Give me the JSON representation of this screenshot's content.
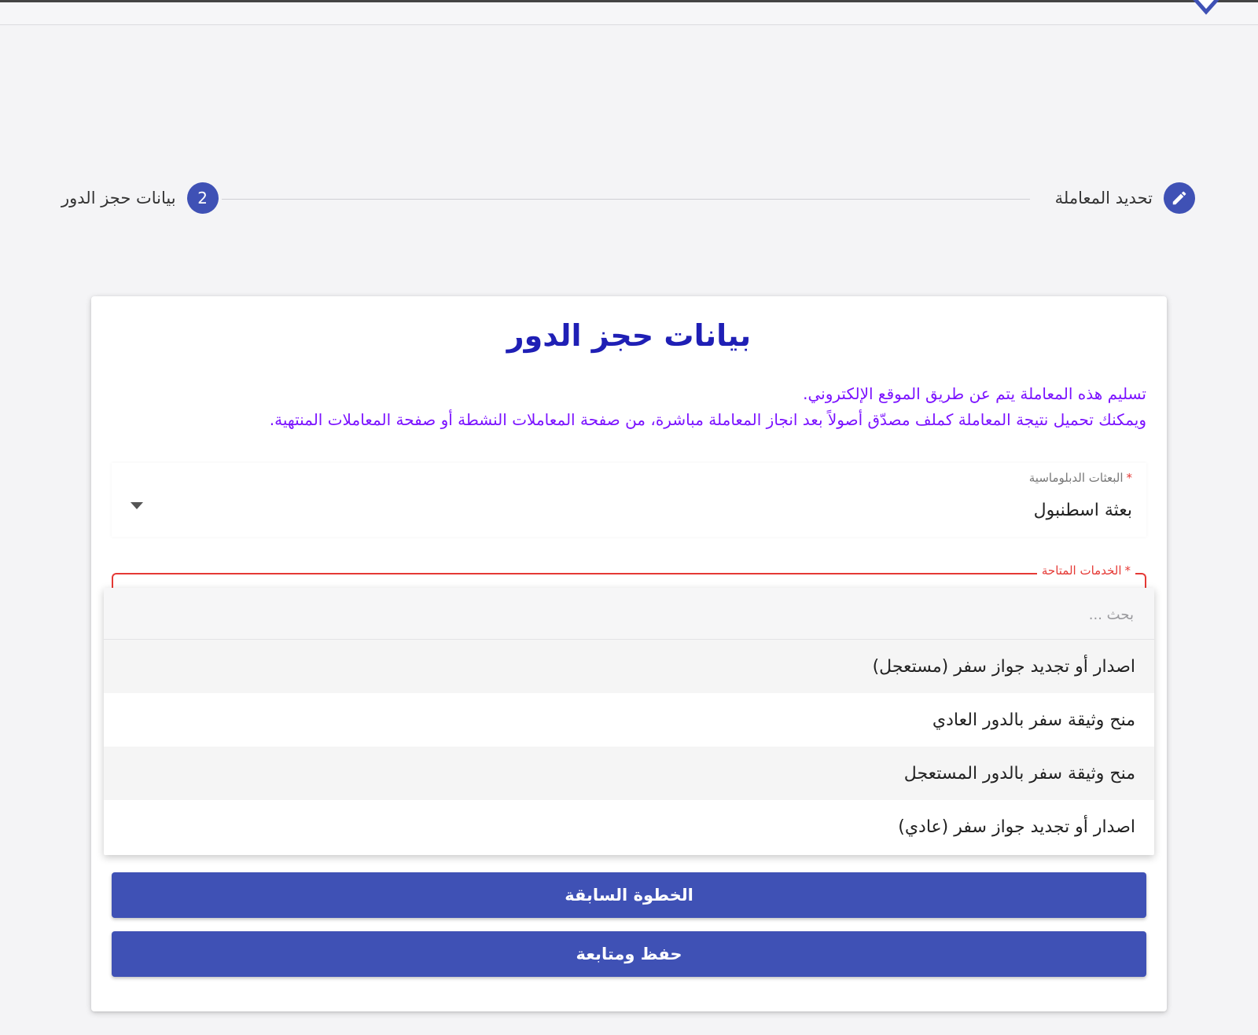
{
  "stepper": {
    "steps": [
      {
        "label": "تحديد المعاملة",
        "icon": "pencil-icon"
      },
      {
        "label": "بيانات حجز الدور",
        "number": "2"
      }
    ]
  },
  "card": {
    "title": "بيانات حجز الدور",
    "notice_line_1": "تسليم هذه المعاملة يتم عن طريق الموقع الإلكتروني.",
    "notice_line_2": "ويمكنك تحميل نتيجة المعاملة كملف مصدّق أصولاً بعد انجاز المعاملة مباشرة، من صفحة المعاملات النشطة أو صفحة المعاملات المنتهية.",
    "notice_color": "#7b12ff",
    "title_color": "#1f1fb5"
  },
  "mission_field": {
    "label": "البعثات الدبلوماسية",
    "required_mark": "*",
    "value": "بعثة اسطنبول"
  },
  "services_field": {
    "label": "الخدمات المتاحة",
    "required_mark": "*",
    "error_color": "#e53935",
    "search_placeholder": "بحث ...",
    "options": [
      "اصدار أو تجديد جواز سفر (مستعجل)",
      "منح وثيقة سفر بالدور العادي",
      "منح وثيقة سفر بالدور المستعجل",
      "اصدار أو تجديد جواز سفر (عادي)"
    ]
  },
  "buttons": {
    "previous": "الخطوة السابقة",
    "save_continue": "حفظ ومتابعة",
    "color": "#3f51b5"
  }
}
